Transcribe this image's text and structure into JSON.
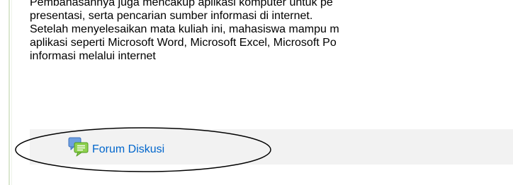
{
  "course_description": {
    "lines": [
      "Pembahasannya juga mencakup aplikasi komputer untuk pe",
      "presentasi, serta pencarian sumber informasi  di internet.",
      "Setelah menyelesaikan mata kuliah ini, mahasiswa mampu m",
      "aplikasi seperti Microsoft Word, Microsoft Excel, Microsoft  Po",
      "informasi melalui  internet"
    ]
  },
  "activity": {
    "icon": "forum-speech-bubbles-icon",
    "label": "Forum Diskusi"
  },
  "colors": {
    "link": "#0066cc",
    "row_background": "#f2f2f2",
    "left_border": "#dbe7d0",
    "annotation": "#000000"
  }
}
